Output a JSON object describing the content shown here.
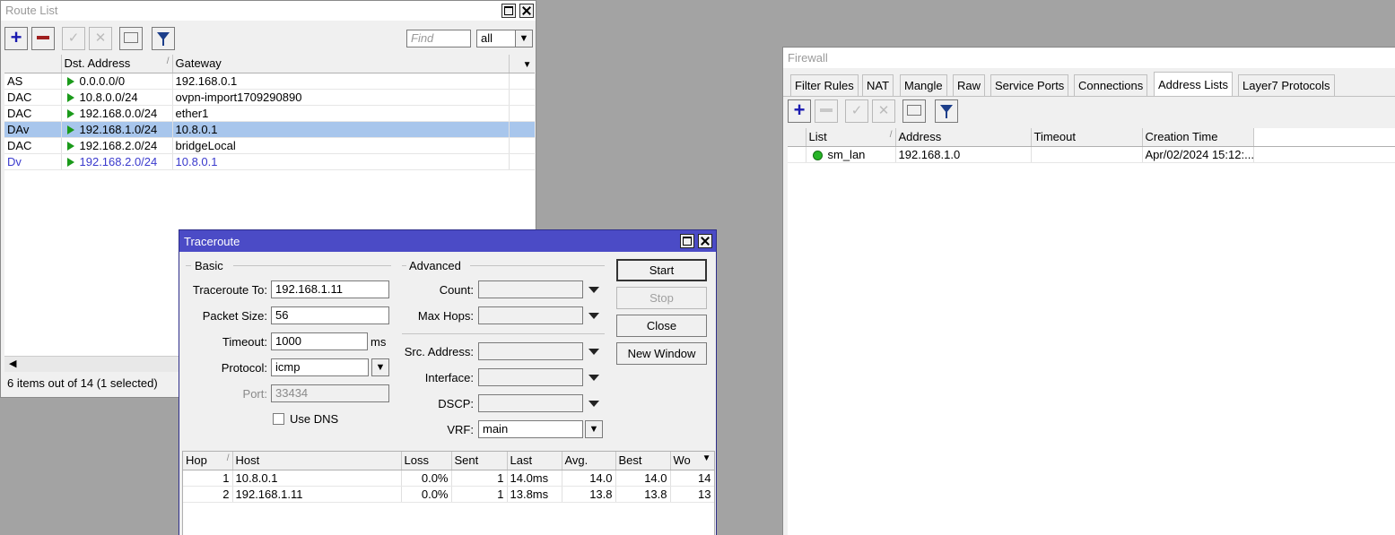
{
  "route_list": {
    "title": "Route List",
    "find_placeholder": "Find",
    "filter_value": "all",
    "columns": [
      "",
      "Dst. Address",
      "Gateway"
    ],
    "rows": [
      {
        "flags": "AS",
        "dst": "0.0.0.0/0",
        "gateway": "192.168.0.1"
      },
      {
        "flags": "DAC",
        "dst": "10.8.0.0/24",
        "gateway": "ovpn-import1709290890"
      },
      {
        "flags": "DAC",
        "dst": "192.168.0.0/24",
        "gateway": "ether1"
      },
      {
        "flags": "DAv",
        "dst": "192.168.1.0/24",
        "gateway": "10.8.0.1"
      },
      {
        "flags": "DAC",
        "dst": "192.168.2.0/24",
        "gateway": "bridgeLocal"
      },
      {
        "flags": "Dv",
        "dst": "192.168.2.0/24",
        "gateway": "10.8.0.1"
      }
    ],
    "status": "6 items out of 14 (1 selected)"
  },
  "traceroute": {
    "title": "Traceroute",
    "basic_label": "Basic",
    "advanced_label": "Advanced",
    "fields": {
      "traceroute_to_label": "Traceroute To:",
      "traceroute_to": "192.168.1.11",
      "packet_size_label": "Packet Size:",
      "packet_size": "56",
      "timeout_label": "Timeout:",
      "timeout": "1000",
      "timeout_unit": "ms",
      "protocol_label": "Protocol:",
      "protocol": "icmp",
      "port_label": "Port:",
      "port": "33434",
      "use_dns_label": "Use DNS"
    },
    "advanced": {
      "count_label": "Count:",
      "max_hops_label": "Max Hops:",
      "src_address_label": "Src. Address:",
      "interface_label": "Interface:",
      "dscp_label": "DSCP:",
      "vrf_label": "VRF:",
      "vrf": "main"
    },
    "buttons": {
      "start": "Start",
      "stop": "Stop",
      "close": "Close",
      "new_window": "New Window"
    },
    "columns": [
      "Hop",
      "Host",
      "Loss",
      "Sent",
      "Last",
      "Avg.",
      "Best",
      "Wo"
    ],
    "rows": [
      {
        "hop": "1",
        "host": "10.8.0.1",
        "loss": "0.0%",
        "sent": "1",
        "last": "14.0ms",
        "avg": "14.0",
        "best": "14.0",
        "worst": "14"
      },
      {
        "hop": "2",
        "host": "192.168.1.11",
        "loss": "0.0%",
        "sent": "1",
        "last": "13.8ms",
        "avg": "13.8",
        "best": "13.8",
        "worst": "13"
      }
    ]
  },
  "firewall": {
    "title": "Firewall",
    "tabs": [
      "Filter Rules",
      "NAT",
      "Mangle",
      "Raw",
      "Service Ports",
      "Connections",
      "Address Lists",
      "Layer7 Protocols"
    ],
    "active_tab": "Address Lists",
    "columns": [
      "List",
      "Address",
      "Timeout",
      "Creation Time"
    ],
    "rows": [
      {
        "list": "sm_lan",
        "address": "192.168.1.0",
        "timeout": "",
        "creation_time": "Apr/02/2024 15:12:..."
      }
    ]
  },
  "colors": {
    "desktop": "#a3a3a3",
    "active_title": "#4b4bc6",
    "selected_row": "#a8c6ec",
    "dynamic_text": "#3a3acd"
  }
}
